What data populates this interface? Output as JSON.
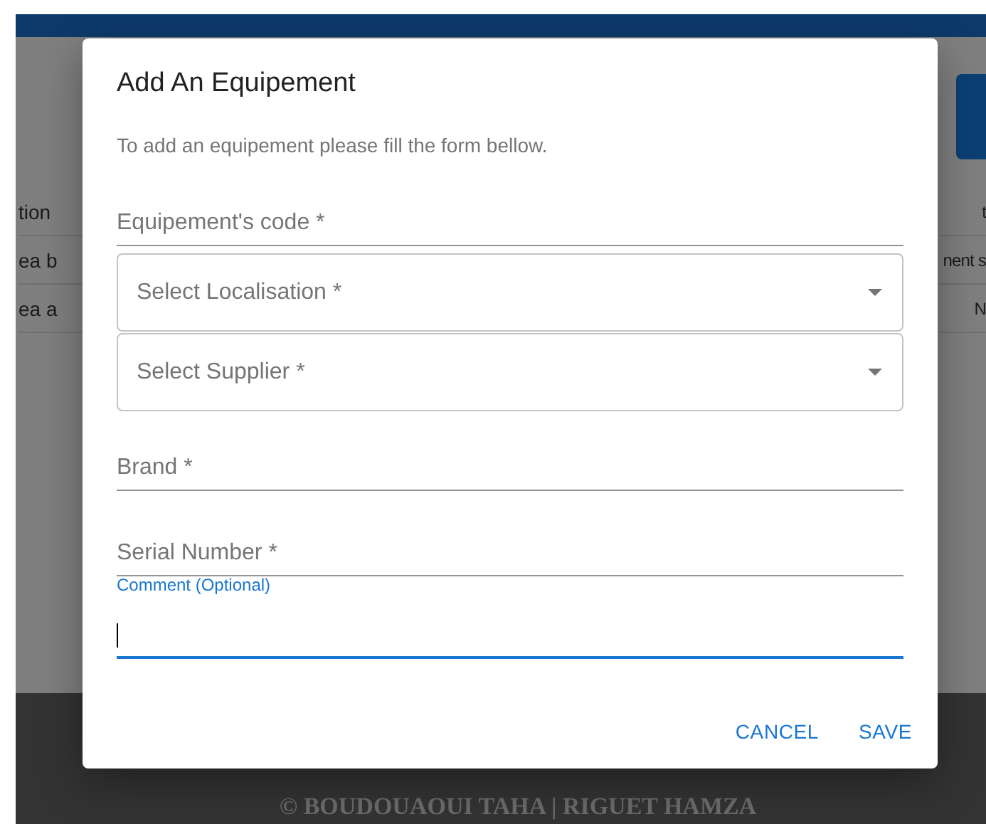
{
  "background": {
    "table": {
      "columns": [
        "tion",
        "t"
      ],
      "rows": [
        [
          "ea b",
          "nent s"
        ],
        [
          "ea a",
          "N"
        ]
      ]
    },
    "footer": "© BOUDOUAOUI TAHA | RIGUET HAMZA"
  },
  "dialog": {
    "title": "Add An Equipement",
    "description": "To add an equipement please fill the form bellow.",
    "fields": [
      {
        "kind": "text",
        "placeholder": "Equipement's code *"
      },
      {
        "kind": "select",
        "placeholder": "Select Localisation *"
      },
      {
        "kind": "select",
        "placeholder": "Select Supplier *"
      },
      {
        "kind": "text",
        "placeholder": "Brand *"
      },
      {
        "kind": "text",
        "placeholder": "Serial Number *"
      },
      {
        "kind": "text",
        "label": "Comment (Optional)",
        "focused": true
      }
    ],
    "buttons": [
      "CANCEL",
      "SAVE"
    ]
  }
}
